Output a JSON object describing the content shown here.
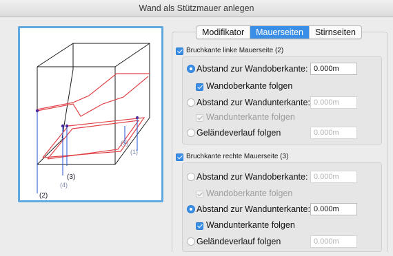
{
  "window": {
    "title": "Wand als Stützmauer anlegen"
  },
  "tabs": [
    {
      "label": "Modifikator",
      "active": false
    },
    {
      "label": "Mauerseiten",
      "active": true
    },
    {
      "label": "Stirnseiten",
      "active": false
    }
  ],
  "preview": {
    "labels": {
      "l1": "(1)",
      "l2": "(2)",
      "l3": "(3)",
      "l4": "(4)",
      "l5": "(5)"
    }
  },
  "left_section": {
    "header": "Bruchkante linke Mauerseite (2)",
    "header_checked": true,
    "rows": {
      "abstand_ober": {
        "label": "Abstand zur Wandoberkante:",
        "selected": true,
        "value": "0.000m"
      },
      "folgen_ober": {
        "label": "Wandoberkante folgen",
        "checked": true
      },
      "abstand_unter": {
        "label": "Abstand zur Wandunterkante:",
        "selected": false,
        "value": "0.000m"
      },
      "folgen_unter": {
        "label": "Wandunterkante folgen",
        "checked": true,
        "disabled": true
      },
      "gelaende": {
        "label": "Geländeverlauf folgen",
        "selected": false,
        "value": "0.000m"
      }
    }
  },
  "right_section": {
    "header": "Bruchkante rechte Mauerseite (3)",
    "header_checked": true,
    "rows": {
      "abstand_ober": {
        "label": "Abstand zur Wandoberkante:",
        "selected": false,
        "value": "0.000m"
      },
      "folgen_ober": {
        "label": "Wandoberkante folgen",
        "checked": true,
        "disabled": true
      },
      "abstand_unter": {
        "label": "Abstand zur Wandunterkante:",
        "selected": true,
        "value": "0.000m"
      },
      "folgen_unter": {
        "label": "Wandunterkante folgen",
        "checked": true
      },
      "gelaende": {
        "label": "Geländeverlauf folgen",
        "selected": false,
        "value": "0.000m"
      }
    }
  },
  "colors": {
    "accent": "#3a8ee6",
    "preview_border": "#5fa8e0",
    "edge_red": "#e0454a",
    "marker_purple": "#4a2a9a"
  }
}
